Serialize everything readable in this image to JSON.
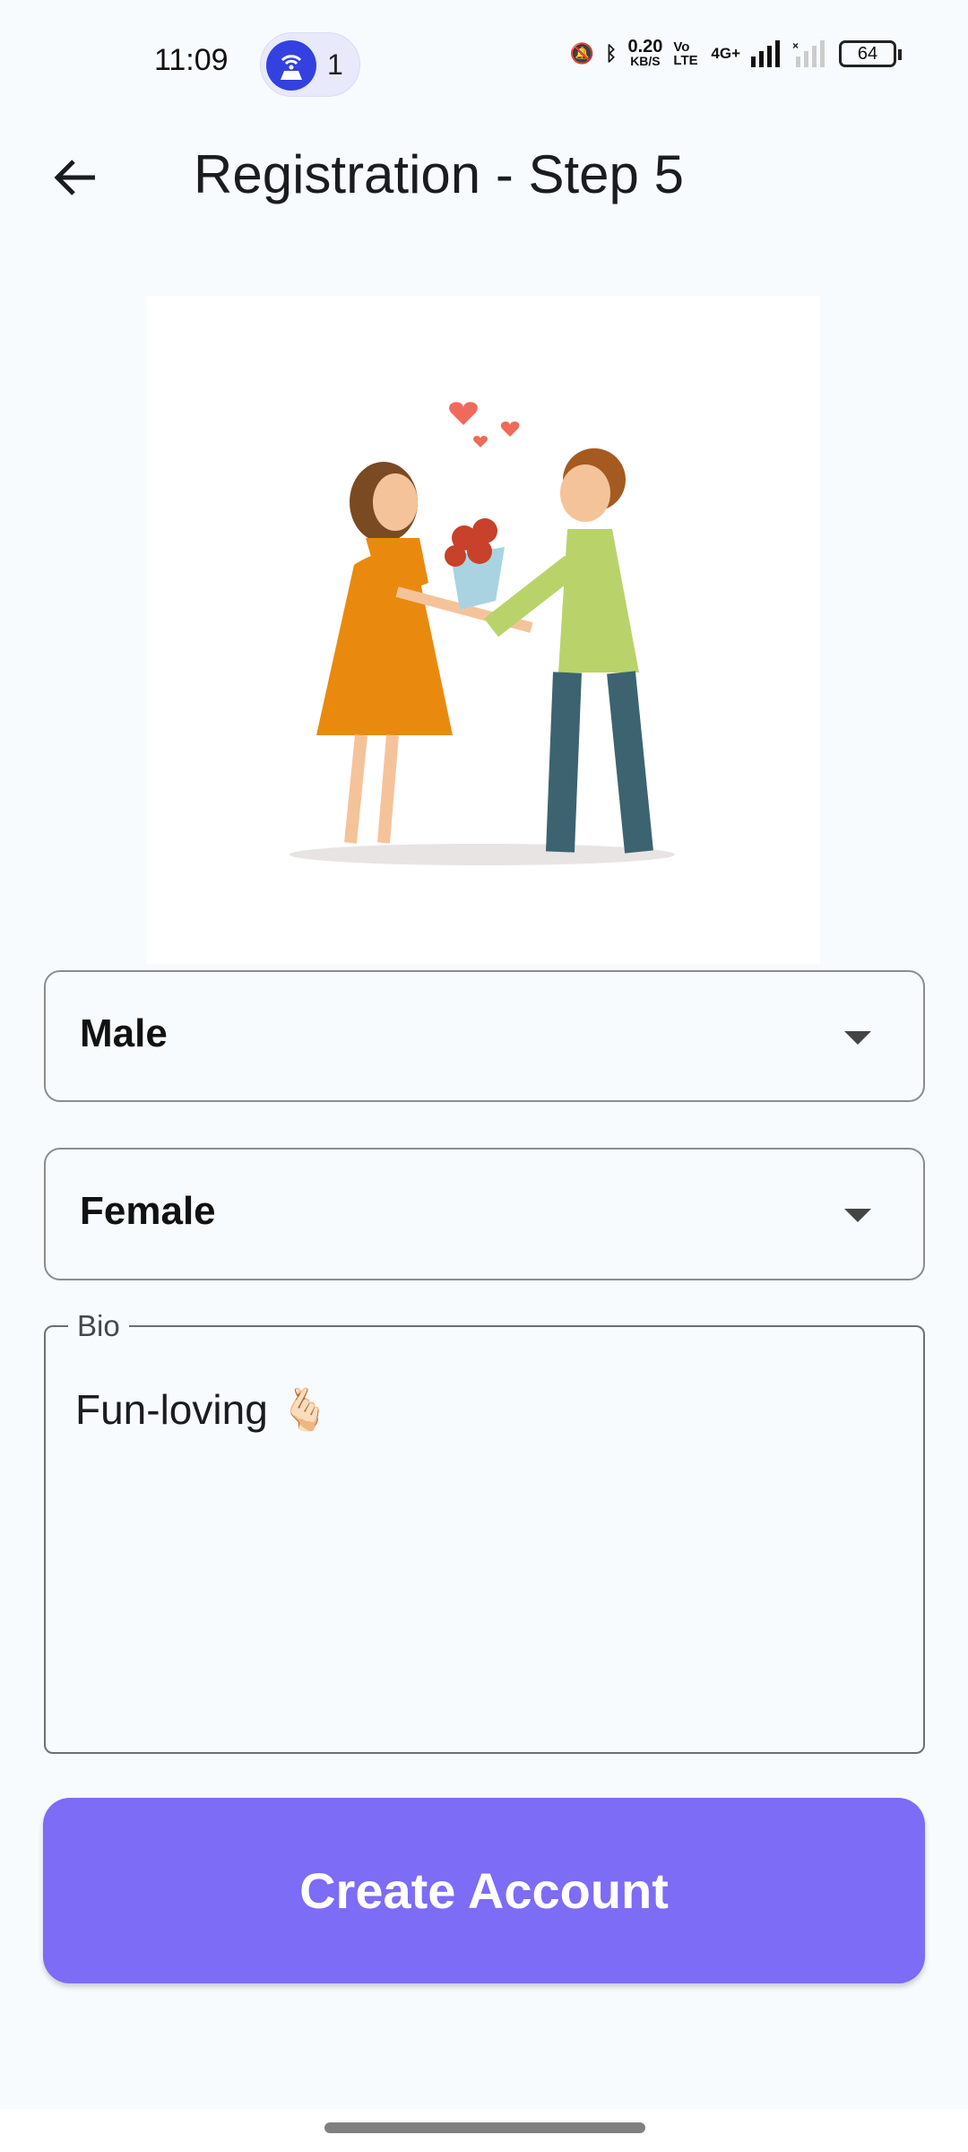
{
  "status_bar": {
    "time": "11:09",
    "hotspot_count": "1",
    "net_speed": "0.20",
    "net_unit": "KB/S",
    "volte": "Vo LTE",
    "network": "4G+",
    "battery": "64"
  },
  "header": {
    "title": "Registration - Step 5",
    "back_icon": "arrow-left-icon"
  },
  "form": {
    "gender_select": {
      "value": "Male"
    },
    "interest_select": {
      "value": "Female"
    },
    "bio": {
      "label": "Bio",
      "value": "Fun-loving 🫰🏻"
    }
  },
  "create_button": {
    "label": "Create Account"
  },
  "colors": {
    "accent": "#7c6cf6",
    "background": "#f7fbfd",
    "hotspot": "#3341e0"
  }
}
